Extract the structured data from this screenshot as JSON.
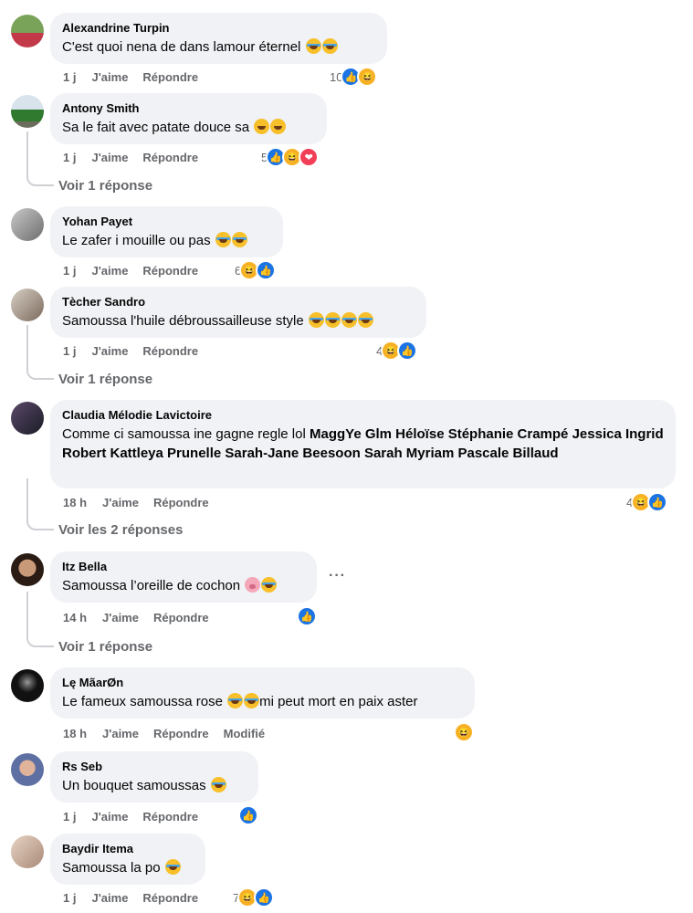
{
  "comments": [
    {
      "author": "Alexandrine Turpin",
      "text": "C'est quoi nena de dans lamour éternel",
      "time": "1 j",
      "like": "J'aime",
      "reply": "Répondre",
      "reaction_count": "10"
    },
    {
      "author": "Antony Smith",
      "text": "Sa le fait avec patate douce sa",
      "time": "1 j",
      "like": "J'aime",
      "reply": "Répondre",
      "reaction_count": "5",
      "replies_link": "Voir 1 réponse"
    },
    {
      "author": "Yohan Payet",
      "text": "Le zafer i mouille ou pas",
      "time": "1 j",
      "like": "J'aime",
      "reply": "Répondre",
      "reaction_count": "6"
    },
    {
      "author": "Tècher Sandro",
      "text": "Samoussa l'huile débroussailleuse style",
      "time": "1 j",
      "like": "J'aime",
      "reply": "Répondre",
      "reaction_count": "4",
      "replies_link": "Voir 1 réponse"
    },
    {
      "author": "Claudia Mélodie Lavictoire",
      "text": "Comme ci samoussa ine gagne regle lol",
      "mentions": "MaggYe Glm Héloïse Stéphanie Crampé Jessica Ingrid Robert Kattleya Prunelle Sarah-Jane Beesoon Sarah Myriam Pascale Billaud",
      "time": "18 h",
      "like": "J'aime",
      "reply": "Répondre",
      "reaction_count": "4",
      "replies_link": "Voir les 2 réponses"
    },
    {
      "author": "Itz Bella",
      "text": "Samoussa l’oreille de cochon",
      "time": "14 h",
      "like": "J'aime",
      "reply": "Répondre",
      "replies_link": "Voir 1 réponse"
    },
    {
      "author": "Lę MãarØn",
      "text_before": "Le fameux samoussa rose",
      "text_after": "mi peut mort en paix aster",
      "time": "18 h",
      "like": "J'aime",
      "reply": "Répondre",
      "edited": "Modifié"
    },
    {
      "author": "Rs Seb",
      "text": "Un bouquet samoussas",
      "time": "1 j",
      "like": "J'aime",
      "reply": "Répondre"
    },
    {
      "author": "Baydir Itema",
      "text": "Samoussa la po",
      "time": "1 j",
      "like": "J'aime",
      "reply": "Répondre",
      "reaction_count": "7"
    }
  ],
  "more_options": "···",
  "colors": {
    "bubble": "#f0f2f5",
    "like": "#1b74e4",
    "haha": "#f7b125",
    "love": "#f33e58",
    "meta": "#65676b"
  }
}
